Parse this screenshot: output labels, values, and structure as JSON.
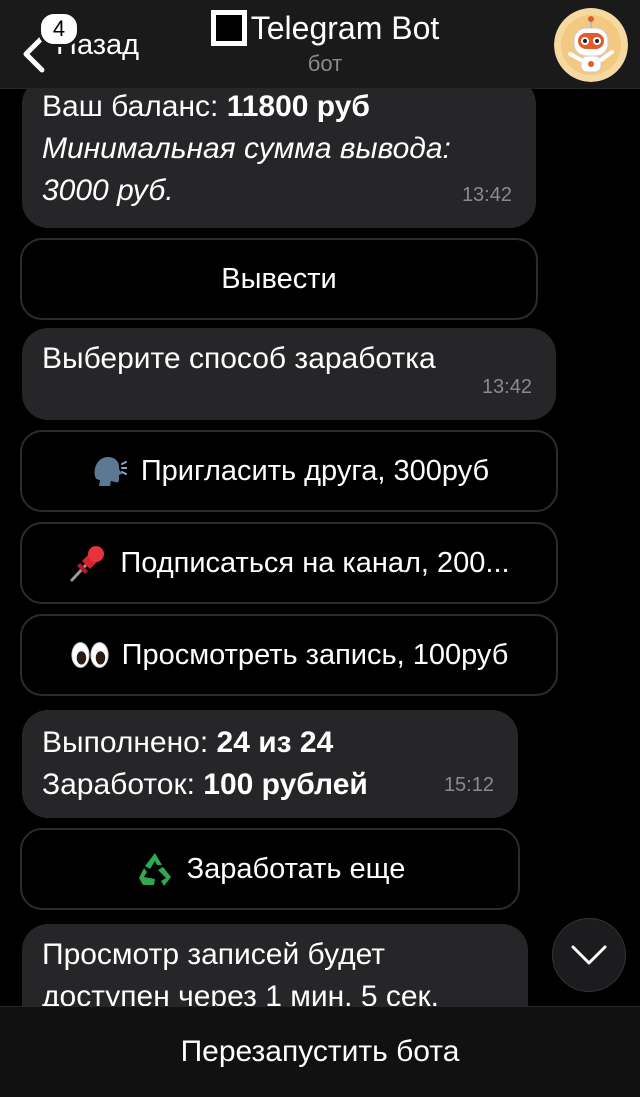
{
  "header": {
    "back_badge": "4",
    "back_label": "Назад",
    "title": "Telegram Bot",
    "subtitle": "бот",
    "avatar_icon": "robot-avatar-icon"
  },
  "messages": [
    {
      "balance_label": "Ваш баланс: ",
      "balance_value": "11800 руб",
      "min_label": "Минимальная сумма вывода:",
      "min_value": "3000 руб.",
      "time": "13:42"
    },
    {
      "text": "Выберите способ заработка",
      "time": "13:42"
    },
    {
      "done_label": "Выполнено: ",
      "done_value": "24 из 24",
      "earn_label": "Заработок: ",
      "earn_value": "100 рублей",
      "time": "15:12"
    },
    {
      "line1": "Просмотр записей будет",
      "line2": "доступен через 1 мин. 5 сек."
    }
  ],
  "buttons": {
    "withdraw": "Вывести",
    "invite": "Пригласить друга, 300руб",
    "subscribe": "Подписаться на канал, 200...",
    "view": "Просмотреть запись, 100руб",
    "earn_more": "Заработать еще"
  },
  "icons": {
    "invite": "speaking-head-icon",
    "subscribe": "pushpin-icon",
    "view": "eyes-icon",
    "earn_more": "recycle-icon",
    "scroll": "chevron-down-icon"
  },
  "bottom": {
    "restart_label": "Перезапустить бота"
  },
  "colors": {
    "background": "#000000",
    "bubble": "#262628",
    "button_border": "#2c2c2e",
    "header": "#1a1a1a",
    "muted_text": "#8a8a8e"
  }
}
